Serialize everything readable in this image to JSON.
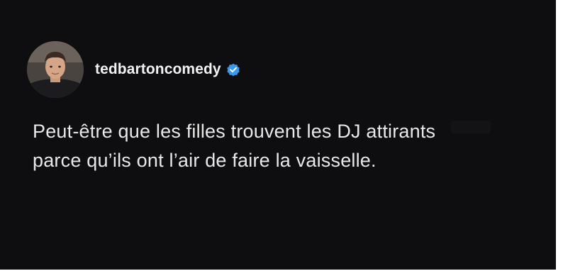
{
  "post": {
    "username": "tedbartoncomedy",
    "verified_icon": "verified-badge-icon",
    "verified_color": "#3897f0",
    "text": "Peut-être que les filles trouvent les DJ attirants parce qu’ils ont l’air de faire la vaisselle."
  }
}
